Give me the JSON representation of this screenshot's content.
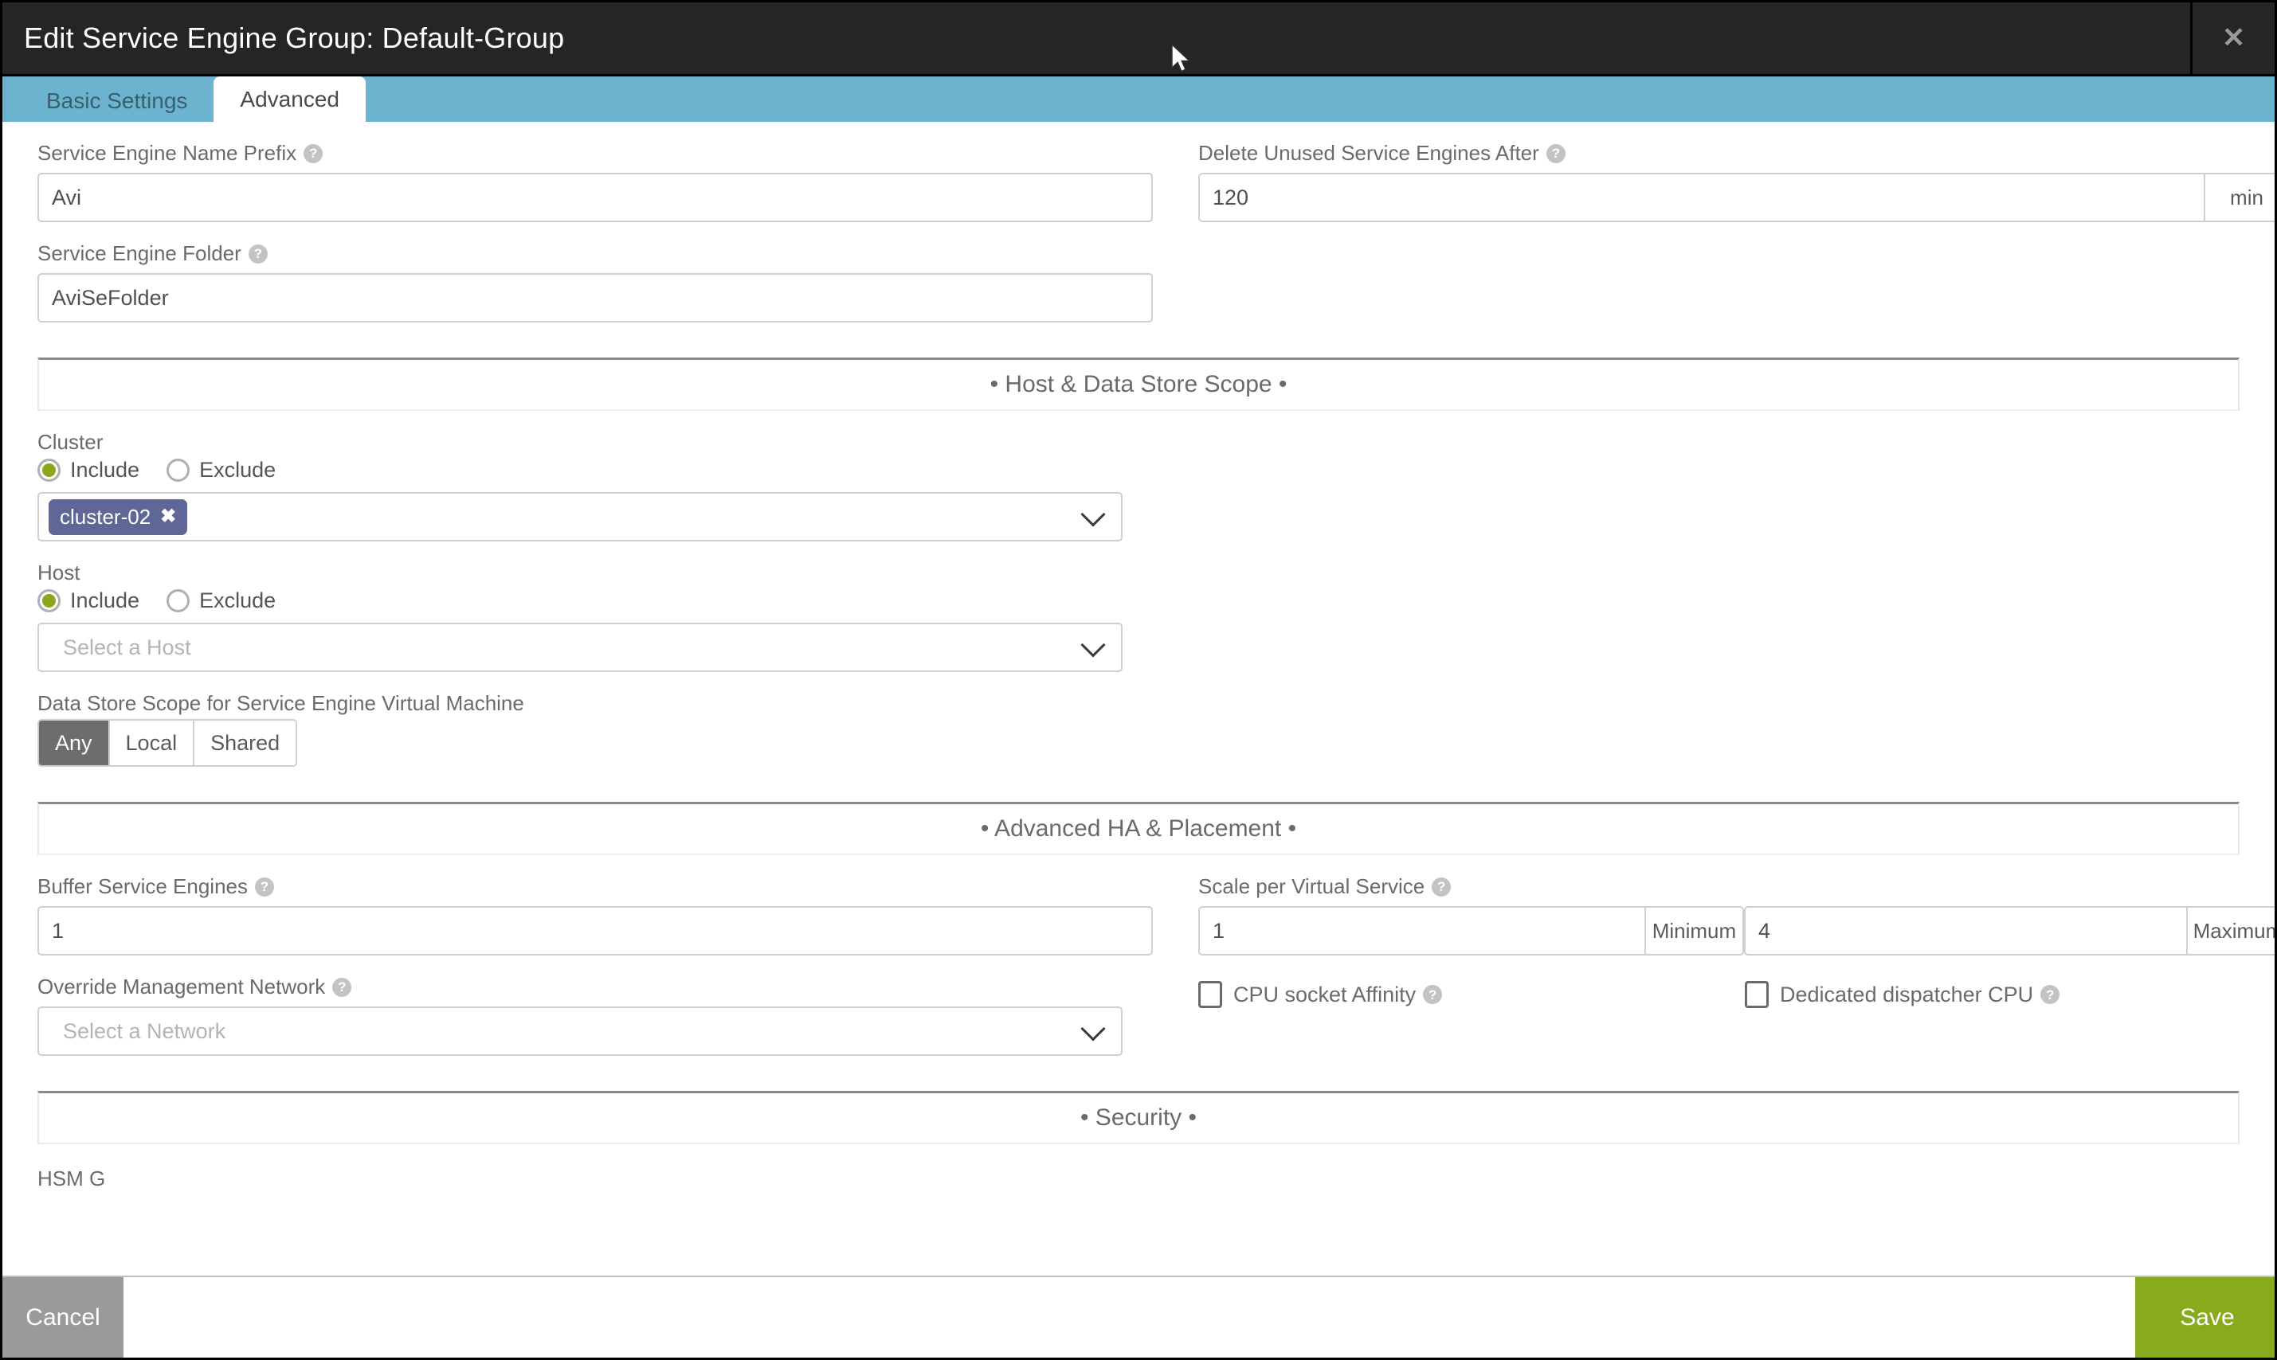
{
  "window": {
    "title": "Edit Service Engine Group: Default-Group",
    "close_label": "✕"
  },
  "tabs": [
    {
      "label": "Basic Settings",
      "active": false
    },
    {
      "label": "Advanced",
      "active": true
    }
  ],
  "help_glyph": "?",
  "form": {
    "se_name_prefix": {
      "label": "Service Engine Name Prefix",
      "value": "Avi"
    },
    "se_folder": {
      "label": "Service Engine Folder",
      "value": "AviSeFolder"
    },
    "delete_unused": {
      "label": "Delete Unused Service Engines After",
      "value": "120",
      "unit": "min"
    }
  },
  "sections": {
    "host_data_store": "• Host & Data Store Scope •",
    "advanced_ha": "• Advanced HA & Placement •",
    "security": "• Security •"
  },
  "cluster": {
    "label": "Cluster",
    "options": [
      {
        "label": "Include",
        "checked": true
      },
      {
        "label": "Exclude",
        "checked": false
      }
    ],
    "chip": "cluster-02",
    "chip_remove": "✖"
  },
  "host": {
    "label": "Host",
    "options": [
      {
        "label": "Include",
        "checked": true
      },
      {
        "label": "Exclude",
        "checked": false
      }
    ],
    "placeholder": "Select a Host"
  },
  "data_store_scope": {
    "label": "Data Store Scope for Service Engine Virtual Machine",
    "options": [
      {
        "label": "Any",
        "selected": true
      },
      {
        "label": "Local",
        "selected": false
      },
      {
        "label": "Shared",
        "selected": false
      }
    ]
  },
  "buffer_service_engines": {
    "label": "Buffer Service Engines",
    "value": "1"
  },
  "scale_per_virtual_service": {
    "label": "Scale per Virtual Service",
    "min_value": "1",
    "min_addon": "Minimum",
    "max_value": "4",
    "max_addon": "Maximum"
  },
  "override_management_network": {
    "label": "Override Management Network",
    "placeholder": "Select a Network"
  },
  "cpu_socket_affinity": {
    "label": "CPU socket Affinity",
    "checked": false
  },
  "dedicated_dispatcher_cpu": {
    "label": "Dedicated dispatcher CPU",
    "checked": false
  },
  "clipped_label": "HSM G",
  "footer": {
    "cancel_label": "Cancel",
    "save_label": "Save"
  },
  "colors": {
    "titlebar": "#252527",
    "tabbar": "#6bb3ce",
    "accent_green": "#89a81e",
    "save_green": "#87ab1c",
    "cancel_gray": "#9a9a9a",
    "chip_purple": "#5f6796",
    "segment_selected": "#6d6d6d"
  }
}
